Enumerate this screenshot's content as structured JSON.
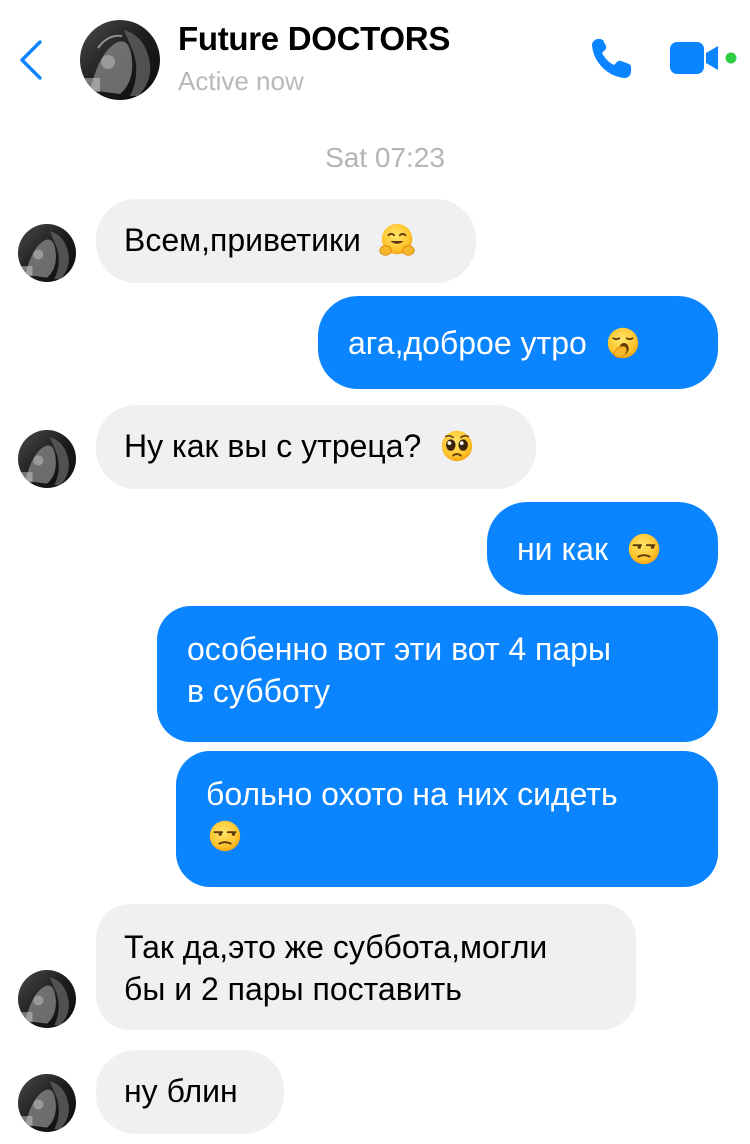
{
  "header": {
    "title": "Future DOCTORS",
    "status": "Active now"
  },
  "timestamp": "Sat 07:23",
  "messages": [
    {
      "direction": "in",
      "text": "Всем,приветики",
      "emoji": "hugging-face-emoji"
    },
    {
      "direction": "out",
      "text": "ага,доброе утро",
      "emoji": "yawning-face-emoji"
    },
    {
      "direction": "in",
      "text": "Ну как вы с утреца?",
      "emoji": "pleading-face-emoji"
    },
    {
      "direction": "out",
      "text": "ни как",
      "emoji": "unamused-face-emoji"
    },
    {
      "direction": "out",
      "lines": [
        "особенно вот эти вот 4 пары",
        "в субботу"
      ]
    },
    {
      "direction": "out",
      "lines": [
        "больно охото на них сидеть"
      ],
      "emoji": "unamused-face-emoji"
    },
    {
      "direction": "in",
      "lines": [
        "Так да,это же суббота,могли",
        "бы и 2 пары поставить"
      ]
    },
    {
      "direction": "in",
      "text": "ну блин"
    }
  ],
  "colors": {
    "outgoing_bubble": "#0a84ff",
    "incoming_bubble": "#f0f0f2",
    "accent": "#0a84ff",
    "active_dot": "#31cc46",
    "secondary_text": "#b8b8bd"
  }
}
